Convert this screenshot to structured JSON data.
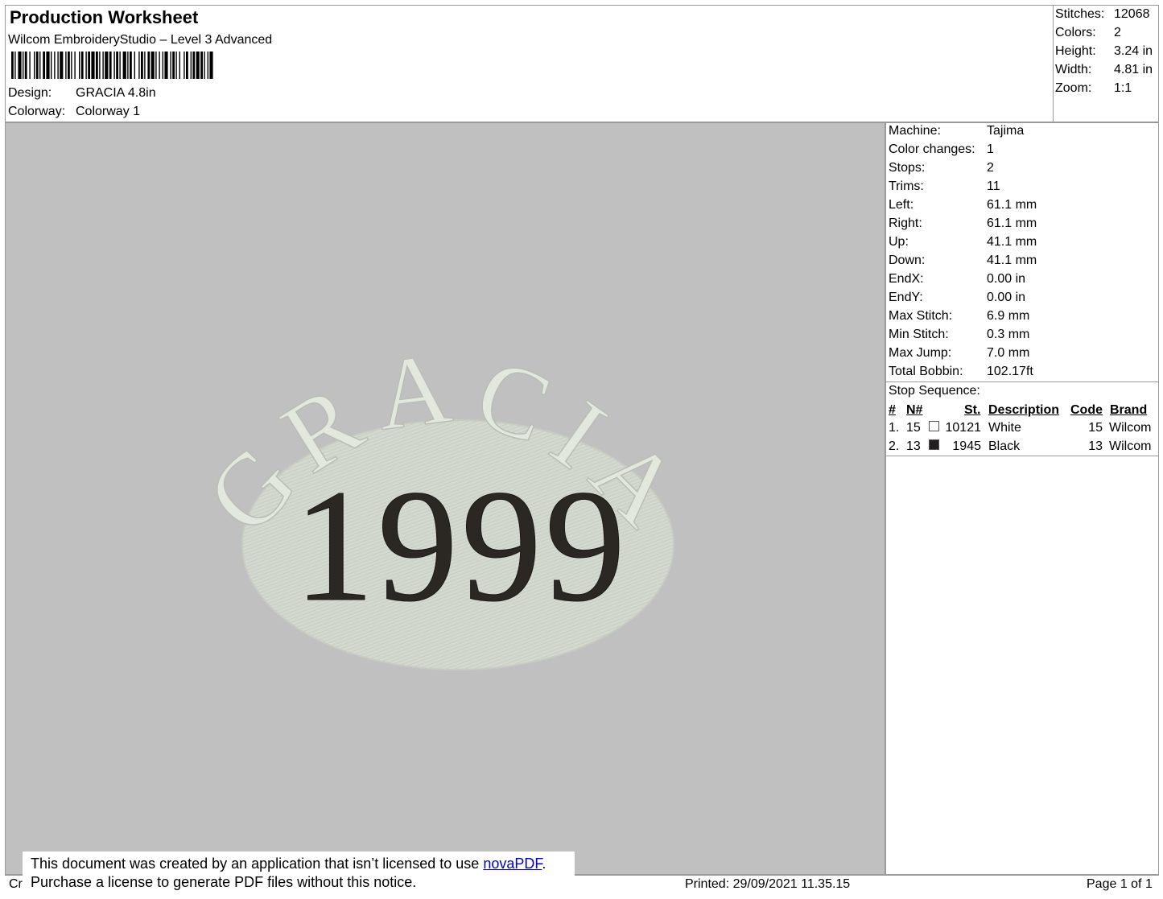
{
  "header": {
    "title": "Production Worksheet",
    "subtitle": "Wilcom EmbroideryStudio – Level 3 Advanced",
    "design_label": "Design:",
    "design_value": "GRACIA 4.8in",
    "colorway_label": "Colorway:",
    "colorway_value": "Colorway 1"
  },
  "stats": [
    {
      "label": "Stitches:",
      "value": "12068"
    },
    {
      "label": "Colors:",
      "value": "2"
    },
    {
      "label": "Height:",
      "value": "3.24 in"
    },
    {
      "label": "Width:",
      "value": "4.81 in"
    },
    {
      "label": "Zoom:",
      "value": "1:1"
    }
  ],
  "machine_info": [
    {
      "label": "Machine:",
      "value": "Tajima"
    },
    {
      "label": "Color changes:",
      "value": "1"
    },
    {
      "label": "Stops:",
      "value": "2"
    },
    {
      "label": "Trims:",
      "value": "11"
    },
    {
      "label": "Left:",
      "value": "61.1 mm"
    },
    {
      "label": "Right:",
      "value": "61.1 mm"
    },
    {
      "label": "Up:",
      "value": "41.1 mm"
    },
    {
      "label": "Down:",
      "value": "41.1 mm"
    },
    {
      "label": "EndX:",
      "value": "0.00 in"
    },
    {
      "label": "EndY:",
      "value": "0.00 in"
    },
    {
      "label": "Max Stitch:",
      "value": "6.9 mm"
    },
    {
      "label": "Min Stitch:",
      "value": "0.3 mm"
    },
    {
      "label": "Max Jump:",
      "value": "7.0 mm"
    },
    {
      "label": "Total Bobbin:",
      "value": "102.17ft"
    }
  ],
  "stop_sequence": {
    "label": "Stop Sequence:",
    "columns": [
      "#",
      "N#",
      "St.",
      "Description",
      "Code",
      "Brand"
    ],
    "rows": [
      {
        "index": "1.",
        "n": "15",
        "swatch_color": "#ffffff",
        "st": "10121",
        "description": "White",
        "code": "15",
        "brand": "Wilcom"
      },
      {
        "index": "2.",
        "n": "13",
        "swatch_color": "#231f20",
        "st": "1945",
        "description": "Black",
        "code": "13",
        "brand": "Wilcom"
      }
    ]
  },
  "design_preview": {
    "arc_text": "GRACIA",
    "center_text": "1999",
    "background_color": "#c0c0c0",
    "thread_white": "#e3e8df",
    "oval_fill": "#d2d7ce",
    "thread_black": "#2b2824"
  },
  "footer": {
    "left_fragment": "Cr",
    "printed": "Printed: 29/09/2021 11.35.15",
    "page": "Page 1 of 1"
  },
  "notice": {
    "line1_prefix": "This document was created by an application that isn’t licensed to use ",
    "link_text": "novaPDF",
    "line1_suffix": ".",
    "line2": "Purchase a license to generate PDF files without this notice."
  }
}
